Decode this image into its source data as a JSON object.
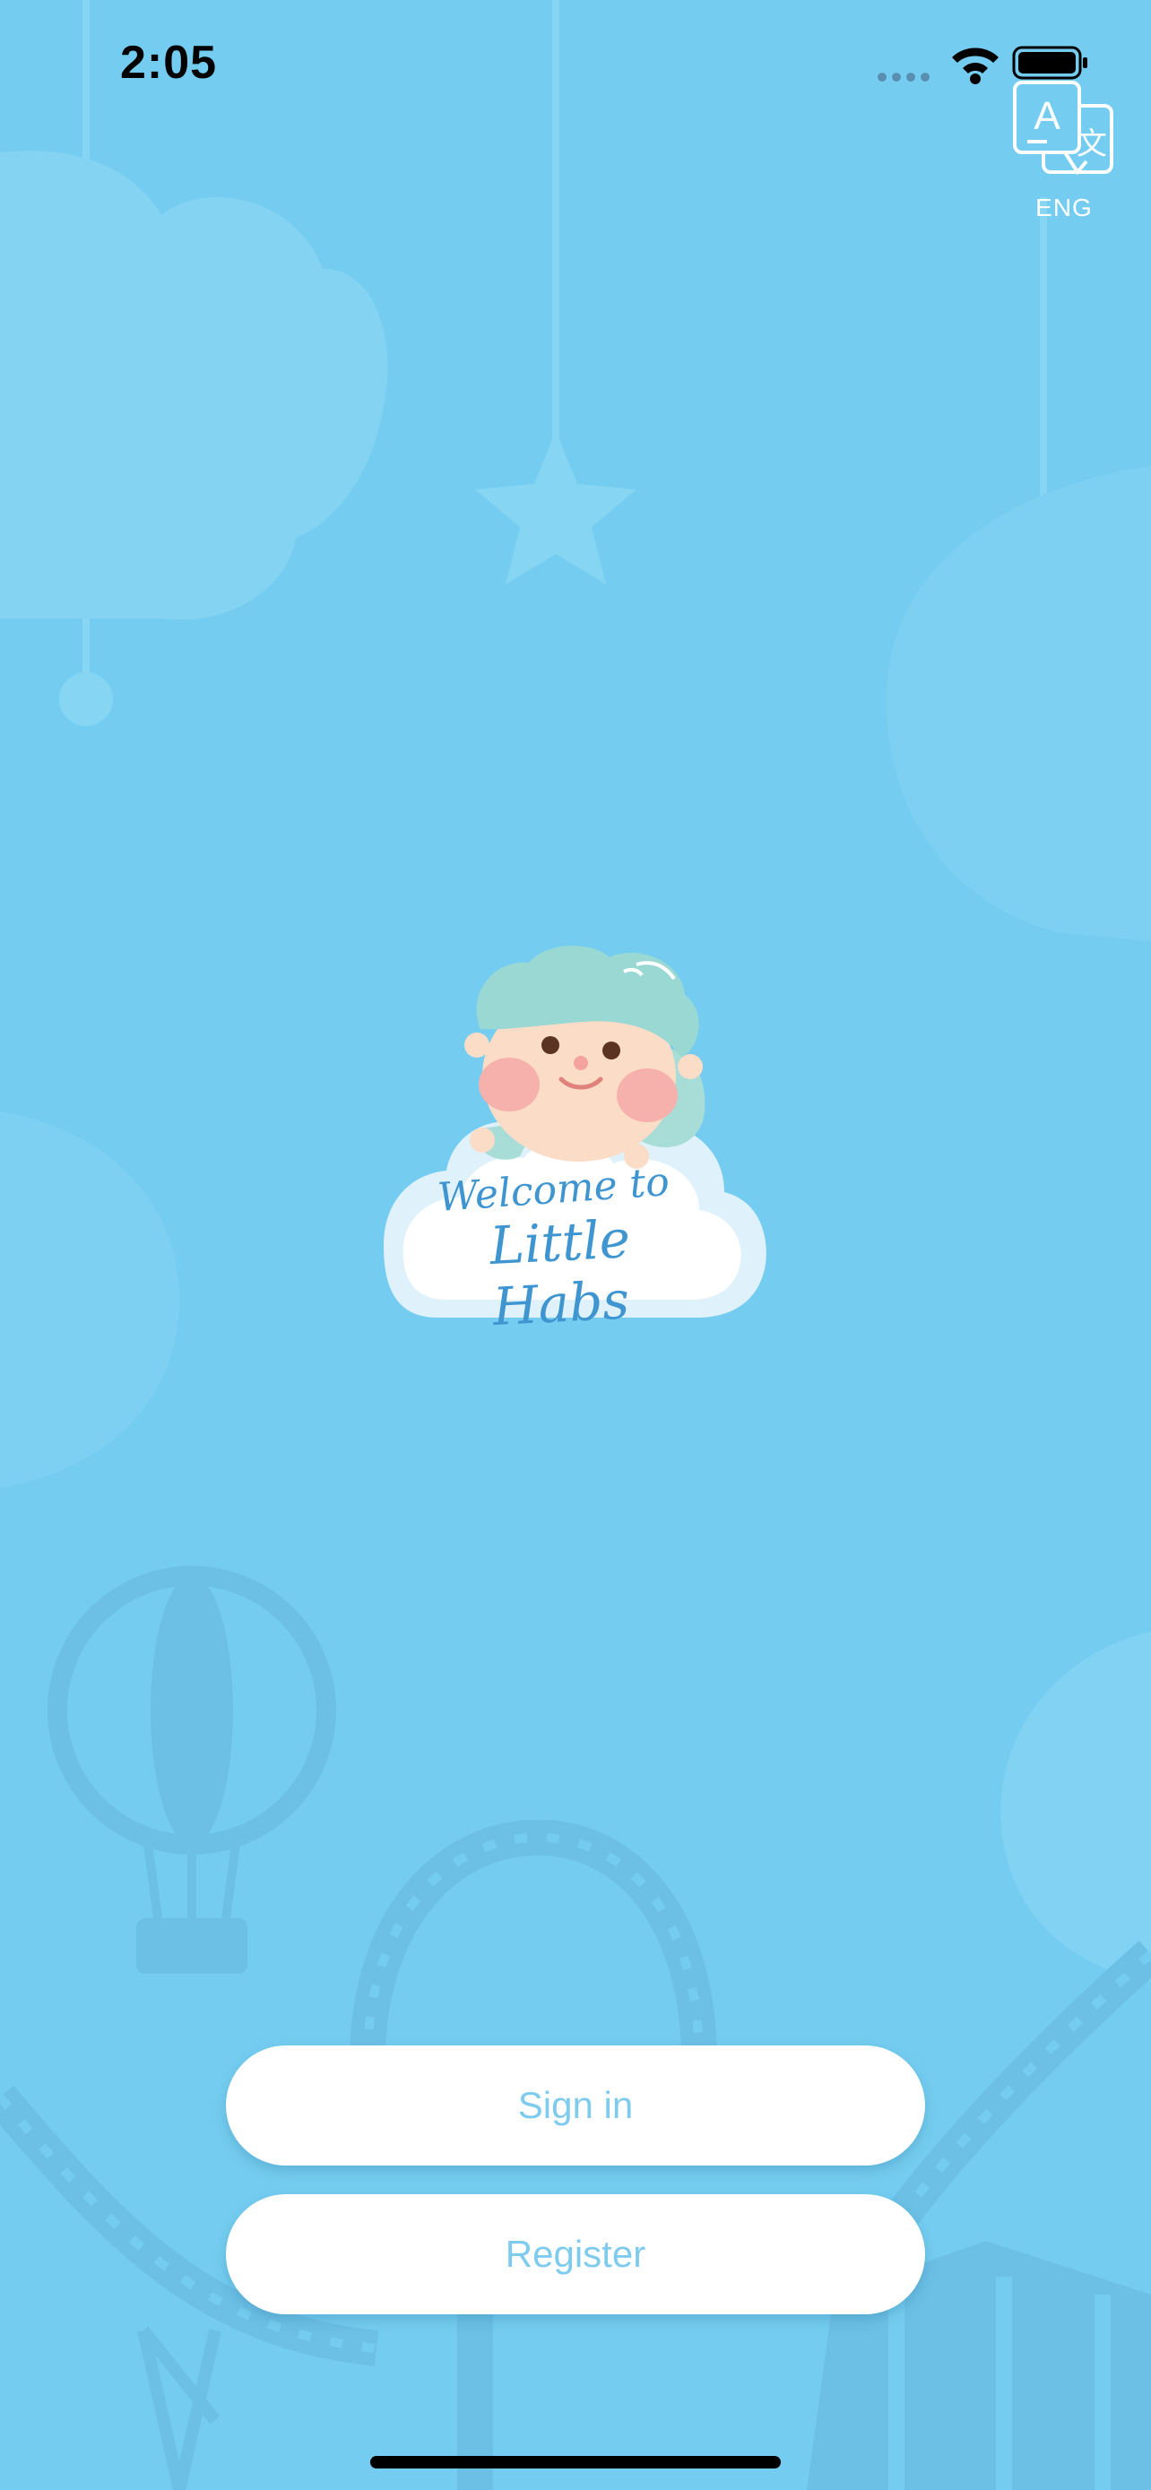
{
  "status_bar": {
    "time": "2:05",
    "icons": [
      "signal-dots-icon",
      "wifi-icon",
      "battery-icon"
    ]
  },
  "language": {
    "label": "ENG",
    "icon": "translate-icon"
  },
  "logo": {
    "line1": "Welcome to",
    "line2": "Little Habs"
  },
  "buttons": {
    "sign_in": "Sign in",
    "register": "Register"
  },
  "colors": {
    "background": "#74cdf0",
    "button_text": "#7fcbee",
    "logo_text": "#3f95cf"
  }
}
